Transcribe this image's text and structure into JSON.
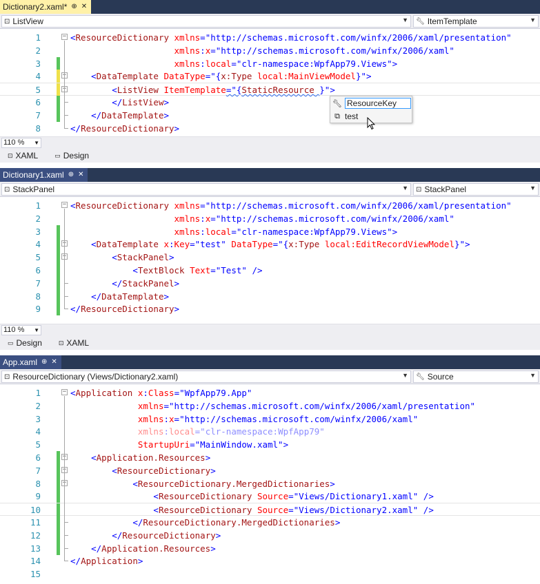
{
  "panes": [
    {
      "tab": {
        "title": "Dictionary2.xaml*",
        "pin": "⊕",
        "close": "✕",
        "active": true
      },
      "nav_left": "ListView",
      "nav_right": "ItemTemplate",
      "lines": [
        {
          "n": "1",
          "html": "<span class=\"p\">&lt;</span><span class=\"t\">ResourceDictionary</span> <span class=\"a\">xmlns</span><span class=\"p\">=\"http://schemas.microsoft.com/winfx/2006/xaml/presentation\"</span>"
        },
        {
          "n": "2",
          "html": "                    <span class=\"a\">xmlns</span><span class=\"p\">:</span><span class=\"a\">x</span><span class=\"p\">=\"http://schemas.microsoft.com/winfx/2006/xaml\"</span>"
        },
        {
          "n": "3",
          "html": "                    <span class=\"a\">xmlns</span><span class=\"p\">:</span><span class=\"a\">local</span><span class=\"p\">=\"clr-namespace:WpfApp79.Views\"</span><span class=\"p\">&gt;</span>"
        },
        {
          "n": "4",
          "html": "    <span class=\"p\">&lt;</span><span class=\"t\">DataTemplate</span> <span class=\"a\">DataType</span><span class=\"p\">=\"{</span><span class=\"t\">x:Type</span> <span class=\"a\">local:MainViewModel</span><span class=\"p\">}\"&gt;</span>"
        },
        {
          "n": "5",
          "html": "        <span class=\"p\">&lt;</span><span class=\"t\">ListView</span> <span class=\"a\">ItemTemplate</span><span class=\"p squig\">=\"{</span><span class=\"t squig\">StaticResource</span><span class=\"squig\"> </span><span class=\"p\">}\"&gt;</span>"
        },
        {
          "n": "6",
          "html": "        <span class=\"p\">&lt;/</span><span class=\"t\">ListView</span><span class=\"p\">&gt;</span>"
        },
        {
          "n": "7",
          "html": "    <span class=\"p\">&lt;/</span><span class=\"t\">DataTemplate</span><span class=\"p\">&gt;</span>"
        },
        {
          "n": "8",
          "html": "<span class=\"p\">&lt;/</span><span class=\"t\">ResourceDictionary</span><span class=\"p\">&gt;</span>"
        }
      ],
      "zoom": "110 %",
      "view_tabs": [
        {
          "label": "XAML",
          "icon": "⊡"
        },
        {
          "label": "Design",
          "icon": "▭"
        }
      ]
    },
    {
      "tab": {
        "title": "Dictionary1.xaml",
        "pin": "⊕",
        "close": "✕",
        "active": false
      },
      "nav_left": "StackPanel",
      "nav_right": "StackPanel",
      "lines": [
        {
          "n": "1",
          "html": "<span class=\"p\">&lt;</span><span class=\"t\">ResourceDictionary</span> <span class=\"a\">xmlns</span><span class=\"p\">=\"http://schemas.microsoft.com/winfx/2006/xaml/presentation\"</span>"
        },
        {
          "n": "2",
          "html": "                    <span class=\"a\">xmlns</span><span class=\"p\">:</span><span class=\"a\">x</span><span class=\"p\">=\"http://schemas.microsoft.com/winfx/2006/xaml\"</span>"
        },
        {
          "n": "3",
          "html": "                    <span class=\"a\">xmlns</span><span class=\"p\">:</span><span class=\"a\">local</span><span class=\"p\">=\"clr-namespace:WpfApp79.Views\"</span><span class=\"p\">&gt;</span>"
        },
        {
          "n": "4",
          "html": "    <span class=\"p\">&lt;</span><span class=\"t\">DataTemplate</span> <span class=\"a\">x</span><span class=\"p\">:</span><span class=\"a\">Key</span><span class=\"p\">=\"test\"</span> <span class=\"a\">DataType</span><span class=\"p\">=\"{</span><span class=\"t\">x:Type</span> <span class=\"a\">local:EditRecordViewModel</span><span class=\"p\">}\"&gt;</span>"
        },
        {
          "n": "5",
          "html": "        <span class=\"p\">&lt;</span><span class=\"t\">StackPanel</span><span class=\"p\">&gt;</span>"
        },
        {
          "n": "6",
          "html": "            <span class=\"p\">&lt;</span><span class=\"t\">TextBlock</span> <span class=\"a\">Text</span><span class=\"p\">=\"Test\"</span> <span class=\"p\">/&gt;</span>"
        },
        {
          "n": "7",
          "html": "        <span class=\"p\">&lt;/</span><span class=\"t\">StackPanel</span><span class=\"p\">&gt;</span>"
        },
        {
          "n": "8",
          "html": "    <span class=\"p\">&lt;/</span><span class=\"t\">DataTemplate</span><span class=\"p\">&gt;</span>"
        },
        {
          "n": "9",
          "html": "<span class=\"p\">&lt;/</span><span class=\"t\">ResourceDictionary</span><span class=\"p\">&gt;</span>"
        }
      ],
      "zoom": "110 %",
      "view_tabs": [
        {
          "label": "Design",
          "icon": "▭"
        },
        {
          "label": "XAML",
          "icon": "⊡"
        }
      ]
    },
    {
      "tab": {
        "title": "App.xaml",
        "pin": "⊕",
        "close": "✕",
        "active": false
      },
      "nav_left": "ResourceDictionary (Views/Dictionary2.xaml)",
      "nav_right": "Source",
      "lines": [
        {
          "n": "1",
          "html": "<span class=\"p\">&lt;</span><span class=\"t\">Application</span> <span class=\"a\">x</span><span class=\"p\">:</span><span class=\"a\">Class</span><span class=\"p\">=\"WpfApp79.App\"</span>"
        },
        {
          "n": "2",
          "html": "             <span class=\"a\">xmlns</span><span class=\"p\">=\"http://schemas.microsoft.com/winfx/2006/xaml/presentation\"</span>"
        },
        {
          "n": "3",
          "html": "             <span class=\"a\">xmlns</span><span class=\"p\">:</span><span class=\"a\">x</span><span class=\"p\">=\"http://schemas.microsoft.com/winfx/2006/xaml\"</span>"
        },
        {
          "n": "4",
          "html": "             <span class=\"dim\"><span class=\"a\">xmlns</span><span class=\"p\">:</span><span class=\"a\">local</span><span class=\"p\">=\"clr-namespace:WpfApp79\"</span></span>"
        },
        {
          "n": "5",
          "html": "             <span class=\"a\">StartupUri</span><span class=\"p\">=\"MainWindow.xaml\"&gt;</span>"
        },
        {
          "n": "6",
          "html": "    <span class=\"p\">&lt;</span><span class=\"t\">Application.Resources</span><span class=\"p\">&gt;</span>"
        },
        {
          "n": "7",
          "html": "        <span class=\"p\">&lt;</span><span class=\"t\">ResourceDictionary</span><span class=\"p\">&gt;</span>"
        },
        {
          "n": "8",
          "html": "            <span class=\"p\">&lt;</span><span class=\"t\">ResourceDictionary.MergedDictionaries</span><span class=\"p\">&gt;</span>"
        },
        {
          "n": "9",
          "html": "                <span class=\"p\">&lt;</span><span class=\"t\">ResourceDictionary</span> <span class=\"a\">Source</span><span class=\"p\">=\"Views/Dictionary1.xaml\"</span> <span class=\"p\">/&gt;</span>"
        },
        {
          "n": "10",
          "html": "                <span class=\"p\">&lt;</span><span class=\"t\">ResourceDictionary</span> <span class=\"a\">Source</span><span class=\"p\">=\"Views/Dictionary2.xaml\"</span> <span class=\"p\">/&gt;</span>"
        },
        {
          "n": "11",
          "html": "            <span class=\"p\">&lt;/</span><span class=\"t\">ResourceDictionary.MergedDictionaries</span><span class=\"p\">&gt;</span>"
        },
        {
          "n": "12",
          "html": "        <span class=\"p\">&lt;/</span><span class=\"t\">ResourceDictionary</span><span class=\"p\">&gt;</span>"
        },
        {
          "n": "13",
          "html": "    <span class=\"p\">&lt;/</span><span class=\"t\">Application.Resources</span><span class=\"p\">&gt;</span>"
        },
        {
          "n": "14",
          "html": "<span class=\"p\">&lt;/</span><span class=\"t\">Application</span><span class=\"p\">&gt;</span>"
        },
        {
          "n": "15",
          "html": ""
        }
      ]
    }
  ],
  "intellisense": {
    "items": [
      {
        "label": "ResourceKey",
        "icon": "wrench-icon"
      },
      {
        "label": "test",
        "icon": "resource-icon"
      }
    ]
  },
  "colors": {
    "tab_bar": "#293955",
    "active_tab": "#fff1a8",
    "line_number": "#2b91af",
    "tag": "#a31515",
    "attribute": "#ff0000",
    "value": "#0000ff",
    "changed_saved": "#57c45b",
    "changed_unsaved": "#efe14a"
  }
}
